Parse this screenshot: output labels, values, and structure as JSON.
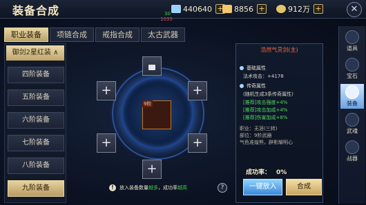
{
  "header": {
    "title": "装备合成"
  },
  "resources": [
    {
      "icon": "gem-icon",
      "value": "440640"
    },
    {
      "icon": "bound-gem-icon",
      "value": "8856"
    },
    {
      "icon": "coin-icon",
      "value": "912万"
    }
  ],
  "debug": {
    "fps": "30",
    "value": "1035"
  },
  "tabs": [
    "职业装备",
    "项链合成",
    "戒指合成",
    "太古武器"
  ],
  "categories": {
    "header": "御剑2星红装",
    "items": [
      "四阶装备",
      "五阶装备",
      "六阶装备",
      "七阶装备",
      "八阶装备",
      "九阶装备"
    ],
    "selected": 5
  },
  "center": {
    "weapon_level": "9阶",
    "note_prefix": "放入装备数量",
    "note_highlight1": "越多",
    "note_mid": "，成功率",
    "note_highlight2": "越高"
  },
  "details": {
    "item_name": "浩然气灵剑(主)",
    "section1": "基础属性",
    "attack": "法术攻击：+4178",
    "section2": "传奇属性",
    "random": "(随机生成3条传奇属性)",
    "legend": [
      "[推荐]攻击强度+4%",
      "[推荐]攻击加成+4%",
      "[推荐]伤害加成+8%"
    ],
    "job": "职业：无涯(三转)",
    "part": "部位：9阶武器",
    "flavor": "气色准煌熊，辟影耀明心",
    "rate_label": "成功率：",
    "rate_value": "0%",
    "btn_auto": "一键放入",
    "btn_combine": "合成"
  },
  "sidebar": [
    "道具",
    "宝石",
    "装备",
    "武魂",
    "战器"
  ],
  "sidebar_selected": 2,
  "colors": {
    "accent": "#e7d6a2",
    "legend_green": "#54d860",
    "item_name": "#ff6b3b"
  }
}
